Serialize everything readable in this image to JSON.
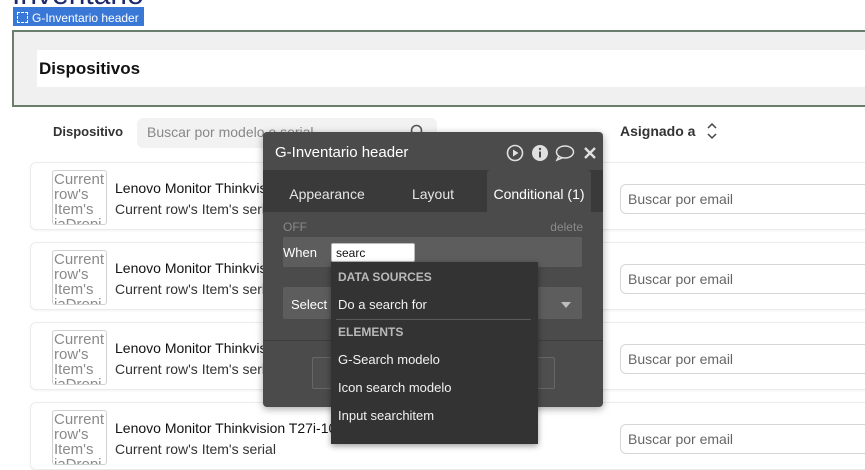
{
  "page": {
    "title": "Inventario",
    "selected_element_tag": "G-Inventario header",
    "header_heading": "Dispositivos"
  },
  "table": {
    "col_dispositivo": "Dispositivo",
    "search_placeholder": "Buscar por modelo o serial",
    "col_asignado": "Asignado a",
    "rows": [
      {
        "thumb_text": "Current row's Item's iaDropi",
        "title": "Lenovo Monitor Thinkvision T27i-10 27\" FHD IPS 1920 10",
        "subtitle": "Current row's Item's serial",
        "email_placeholder": "Buscar por email"
      },
      {
        "thumb_text": "Current row's Item's iaDropi",
        "title": "Lenovo Monitor Thinkvision T27i-10 27\" FHD IPS 1920 10",
        "subtitle": "Current row's Item's serial",
        "email_placeholder": "Buscar por email"
      },
      {
        "thumb_text": "Current row's Item's iaDropi",
        "title": "Lenovo Monitor Thinkvision T27i-10 27\" FHD IPS 1920 10",
        "subtitle": "Current row's Item's serial",
        "email_placeholder": "Buscar por email"
      },
      {
        "thumb_text": "Current row's Item's iaDropi",
        "title": "Lenovo Monitor Thinkvision T27i-10 27\" FHD IPS 1920 10",
        "subtitle": "Current row's Item's serial",
        "email_placeholder": "Buscar por email"
      }
    ]
  },
  "editor": {
    "title": "G-Inventario header",
    "tabs": [
      "Appearance",
      "Layout",
      "Conditional (1)"
    ],
    "active_tab": "Conditional (1)",
    "off_label": "OFF",
    "delete_label": "delete",
    "when_label": "When",
    "when_value": "searc",
    "select_placeholder": "Select a property to change when true",
    "icons": [
      "play-icon",
      "info-icon",
      "comment-icon",
      "close-icon"
    ]
  },
  "dropdown": {
    "section_data_sources": "DATA SOURCES",
    "item_search_for": "Do a search for",
    "section_elements": "ELEMENTS",
    "elements": [
      "G-Search modelo",
      "Icon search modelo",
      "Input searchitem"
    ]
  },
  "colors": {
    "selection_tag": "#3a78d8",
    "editor_bg": "#4b4b4b",
    "dropdown_bg": "#333333",
    "title_blue": "#1e2a6e"
  }
}
